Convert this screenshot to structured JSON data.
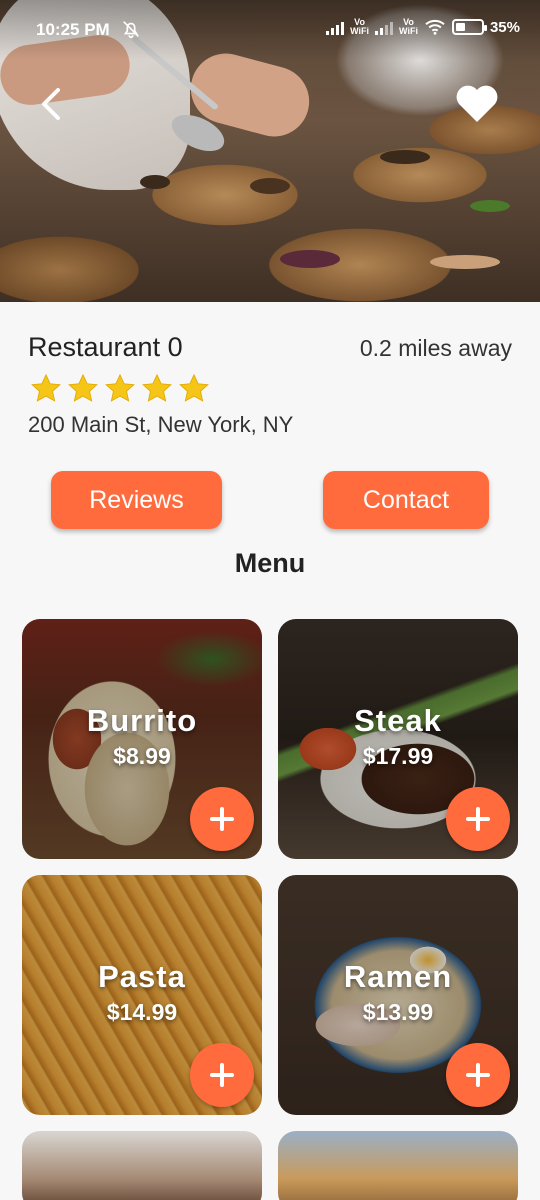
{
  "status_bar": {
    "time": "10:25 PM",
    "battery": "35%",
    "volte_label_1": "Vo\nWiFi",
    "volte_label_2": "Vo\nWiFi"
  },
  "restaurant": {
    "name": "Restaurant 0",
    "distance": "0.2 miles away",
    "rating": 5,
    "address": "200 Main St, New York, NY"
  },
  "actions": {
    "reviews_label": "Reviews",
    "contact_label": "Contact"
  },
  "menu": {
    "title": "Menu",
    "items": [
      {
        "name": "Burrito",
        "price": "$8.99"
      },
      {
        "name": "Steak",
        "price": "$17.99"
      },
      {
        "name": "Pasta",
        "price": "$14.99"
      },
      {
        "name": "Ramen",
        "price": "$13.99"
      }
    ]
  },
  "colors": {
    "accent": "#ff6b3d",
    "star": "#f5c518",
    "background": "#f7f7f7"
  },
  "icons": {
    "back": "chevron-left-icon",
    "favorite": "heart-icon",
    "add": "plus-icon",
    "mute": "bell-off-icon",
    "wifi": "wifi-icon",
    "battery": "battery-icon"
  }
}
